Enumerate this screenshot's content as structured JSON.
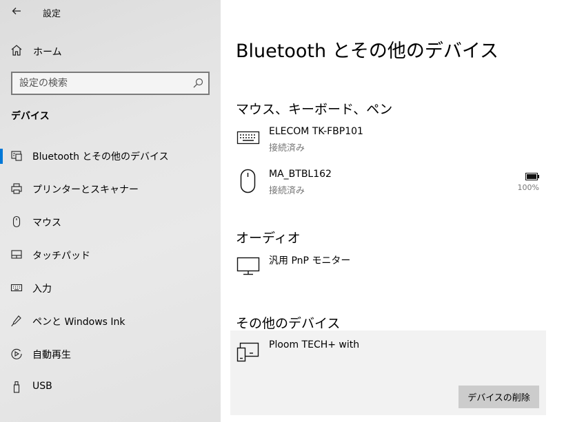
{
  "app": {
    "title": "設定"
  },
  "sidebar": {
    "home_label": "ホーム",
    "search_placeholder": "設定の検索",
    "section_title": "デバイス",
    "items": [
      {
        "label": "Bluetooth とその他のデバイス",
        "icon": "bluetooth-devices-icon",
        "selected": true
      },
      {
        "label": "プリンターとスキャナー",
        "icon": "printer-icon",
        "selected": false
      },
      {
        "label": "マウス",
        "icon": "mouse-icon",
        "selected": false
      },
      {
        "label": "タッチパッド",
        "icon": "touchpad-icon",
        "selected": false
      },
      {
        "label": "入力",
        "icon": "keyboard-icon",
        "selected": false
      },
      {
        "label": "ペンと Windows Ink",
        "icon": "pen-icon",
        "selected": false
      },
      {
        "label": "自動再生",
        "icon": "autoplay-icon",
        "selected": false
      },
      {
        "label": "USB",
        "icon": "usb-icon",
        "selected": false
      }
    ]
  },
  "main": {
    "title": "Bluetooth とその他のデバイス",
    "groups": {
      "input": {
        "title": "マウス、キーボード、ペン",
        "devices": [
          {
            "name": "ELECOM TK-FBP101",
            "status": "接続済み",
            "icon": "keyboard-icon"
          },
          {
            "name": "MA_BTBL162",
            "status": "接続済み",
            "icon": "mouse-icon",
            "battery": "100%"
          }
        ]
      },
      "audio": {
        "title": "オーディオ",
        "devices": [
          {
            "name": "汎用 PnP モニター",
            "icon": "monitor-icon"
          }
        ]
      },
      "other": {
        "title": "その他のデバイス",
        "devices": [
          {
            "name": "Ploom TECH+ with",
            "icon": "devices-icon"
          }
        ]
      }
    },
    "remove_button": "デバイスの削除"
  },
  "colors": {
    "accent": "#0078d7",
    "secondary_text": "#767676",
    "card_bg": "#f2f2f2",
    "button_bg": "#cccccc"
  }
}
